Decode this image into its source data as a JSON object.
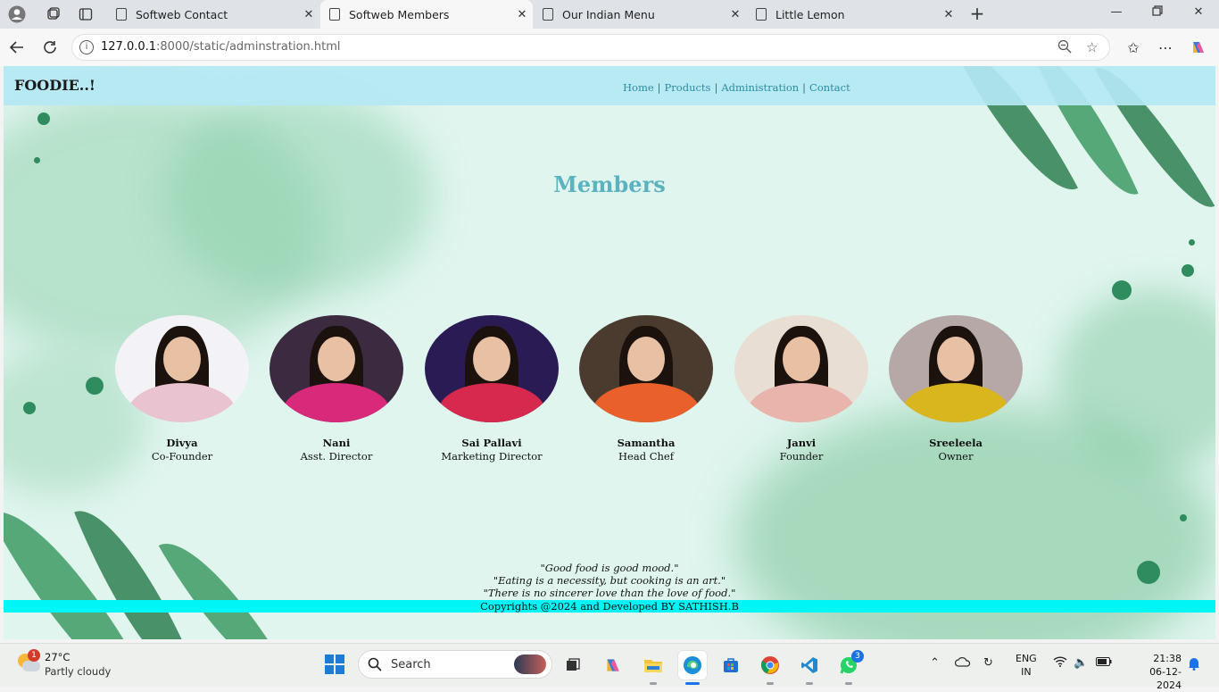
{
  "browser": {
    "tabs": [
      {
        "title": "Softweb Contact",
        "active": false
      },
      {
        "title": "Softweb Members",
        "active": true
      },
      {
        "title": "Our Indian Menu",
        "active": false
      },
      {
        "title": "Little Lemon",
        "active": false
      }
    ],
    "url_host": "127.0.0.1",
    "url_rest": ":8000/static/adminstration.html"
  },
  "site": {
    "brand": "FOODIE..!",
    "nav": [
      "Home",
      "Products",
      "Administration",
      "Contact"
    ],
    "nav_separator": "|",
    "heading": "Members",
    "members": [
      {
        "name": "Divya",
        "role": "Co-Founder",
        "outfit": "#e9c3cf",
        "bg": "#f3f3f7"
      },
      {
        "name": "Nani",
        "role": "Asst. Director",
        "outfit": "#d8297a",
        "bg": "#3b2a40"
      },
      {
        "name": "Sai Pallavi",
        "role": "Marketing Director",
        "outfit": "#d7284e",
        "bg": "#2a1b55"
      },
      {
        "name": "Samantha",
        "role": "Head Chef",
        "outfit": "#e9602a",
        "bg": "#4a3b2e"
      },
      {
        "name": "Janvi",
        "role": "Founder",
        "outfit": "#e8b4ac",
        "bg": "#e9ded3"
      },
      {
        "name": "Sreeleela",
        "role": "Owner",
        "outfit": "#d9b51e",
        "bg": "#b5a8a6"
      }
    ],
    "quotes": [
      "\"Good food is good mood.\"",
      "\"Eating is a necessity, but cooking is an art.\"",
      "\"There is no sincerer love than the love of food.\""
    ],
    "footer": "Copyrights @2024 and Developed BY SATHISH.B"
  },
  "taskbar": {
    "weather_badge": "1",
    "temperature": "27°C",
    "condition": "Partly cloudy",
    "search_label": "Search",
    "whatsapp_badge": "3",
    "lang_line1": "ENG",
    "lang_line2": "IN",
    "time": "21:38",
    "date": "06-12-2024"
  }
}
